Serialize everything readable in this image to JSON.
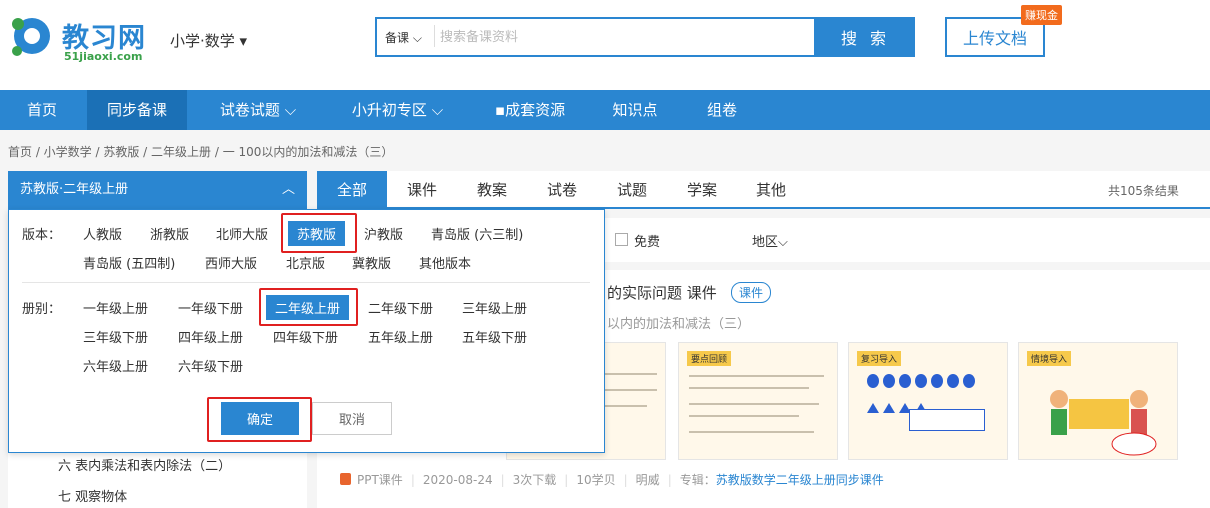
{
  "header": {
    "logo_text": "教习网",
    "logo_sub": "51jiaoxi.com",
    "subject": "小学·数学 ▾",
    "search_type": "备课",
    "search_placeholder": "搜索备课资料",
    "search_button": "搜 索",
    "upload_button": "上传文档",
    "earn_badge": "赚现金"
  },
  "nav": {
    "items": [
      "首页",
      "同步备课",
      "试卷试题  ⌵",
      "小升初专区  ⌵",
      "▪成套资源",
      "知识点",
      "组卷"
    ]
  },
  "breadcrumb": "首页 /  小学数学 / 苏教版 / 二年级上册 / 一 100以内的加法和减法（三）",
  "left": {
    "header": "苏教版·二年级上册",
    "items": [
      "六 表内乘法和表内除法（二）",
      "七 观察物体"
    ]
  },
  "tabs": [
    "全部",
    "课件",
    "教案",
    "试卷",
    "试题",
    "学案",
    "其他"
  ],
  "result_count": "共105条结果",
  "filter": {
    "free": "免费",
    "region": "地区⌵"
  },
  "course": {
    "title": "的实际问题 课件",
    "tag": "课件",
    "subtitle": "以内的加法和减法（三）",
    "thumbs": [
      "",
      "要点回顾",
      "复习导入",
      "情境导入"
    ],
    "meta": {
      "type": "PPT课件",
      "date": "2020-08-24",
      "downloads": "3次下载",
      "points": "10学贝",
      "author": "明威",
      "album_label": "专辑：",
      "album": "苏教版数学二年级上册同步课件"
    }
  },
  "dropdown": {
    "edition_label": "版本：",
    "editions": [
      "人教版",
      "浙教版",
      "北师大版",
      "苏教版",
      "沪教版",
      "青岛版 (六三制)",
      "青岛版 (五四制)",
      "西师大版",
      "北京版",
      "冀教版",
      "其他版本"
    ],
    "selected_edition": "苏教版",
    "volume_label": "册别：",
    "volumes": [
      "一年级上册",
      "一年级下册",
      "二年级上册",
      "二年级下册",
      "三年级上册",
      "三年级下册",
      "四年级上册",
      "四年级下册",
      "五年级上册",
      "五年级下册",
      "六年级上册",
      "六年级下册"
    ],
    "selected_volume": "二年级上册",
    "ok": "确定",
    "cancel": "取消"
  },
  "colors": {
    "brand": "#2a86d1",
    "highlight": "#e02020",
    "badge": "#f26b1d"
  }
}
